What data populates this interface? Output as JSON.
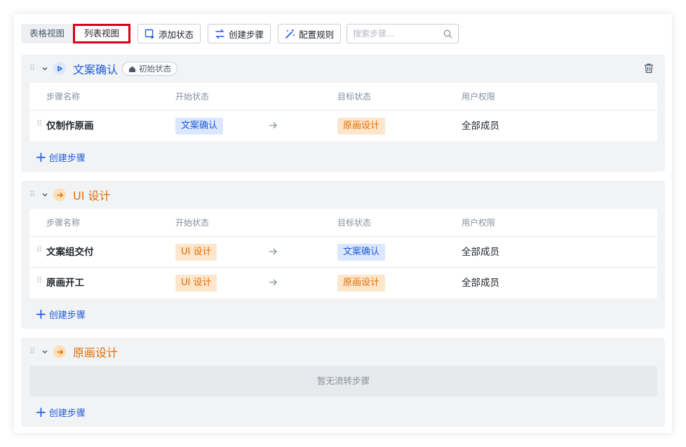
{
  "toolbar": {
    "table_view": "表格视图",
    "list_view": "列表视图",
    "add_status": "添加状态",
    "create_step": "创建步骤",
    "config_rules": "配置规则",
    "search_placeholder": "搜索步骤..."
  },
  "columns": {
    "step_name": "步骤名称",
    "start_status": "开始状态",
    "target_status": "目标状态",
    "user_permission": "用户权限"
  },
  "groups": [
    {
      "title": "文案确认",
      "title_color": "#1f5bd8",
      "icon": "play-icon",
      "initial_tag": "初始状态",
      "rows": [
        {
          "name": "仅制作原画",
          "start": "文案确认",
          "target": "原画设计",
          "permission": "全部成员"
        }
      ],
      "create_step": "创建步骤"
    },
    {
      "title": "UI 设计",
      "title_color": "#e26d00",
      "icon": "arrow-right-icon",
      "rows": [
        {
          "name": "文案组交付",
          "start": "UI 设计",
          "target": "文案确认",
          "permission": "全部成员"
        },
        {
          "name": "原画开工",
          "start": "UI 设计",
          "target": "原画设计",
          "permission": "全部成员"
        }
      ],
      "create_step": "创建步骤"
    },
    {
      "title": "原画设计",
      "title_color": "#e26d00",
      "icon": "arrow-right-icon",
      "empty_text": "暂无流转步骤",
      "create_step": "创建步骤"
    }
  ],
  "colors": {
    "blue": "#1f5bd8",
    "orange": "#e26d00",
    "highlight": "#d9001b"
  }
}
